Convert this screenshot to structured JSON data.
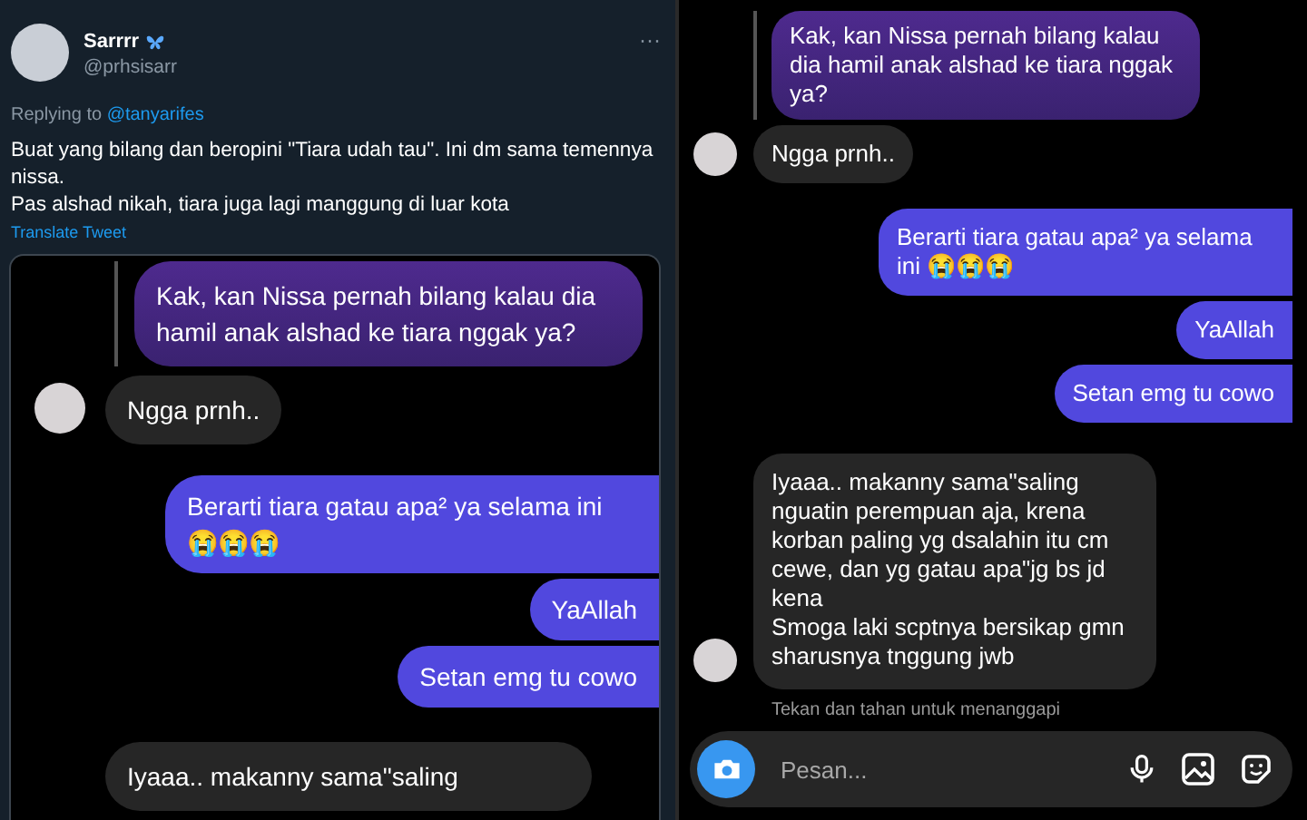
{
  "tweet": {
    "author": "Sarrrr",
    "handle": "@prhsisarr",
    "replying_prefix": "Replying to",
    "reply_handle": "@tanyarifes",
    "paragraphs": [
      "Buat yang bilang dan beropini \"Tiara udah tau\". Ini dm sama temennya nissa.",
      "Pas alshad nikah, tiara juga lagi manggung di luar kota"
    ],
    "translate": "Translate Tweet",
    "more": "···"
  },
  "left_chat": {
    "messages": [
      {
        "kind": "quote",
        "text": "Kak, kan Nissa pernah bilang kalau dia hamil anak alshad ke tiara nggak ya?"
      },
      {
        "kind": "received",
        "text": "Ngga prnh..",
        "avatar": true
      },
      {
        "kind": "sent",
        "text": "Berarti tiara gatau apa² ya selama ini 😭😭😭"
      },
      {
        "kind": "sent",
        "text": "YaAllah"
      },
      {
        "kind": "sent",
        "text": "Setan emg tu cowo"
      },
      {
        "kind": "received",
        "text": "Iyaaa.. makanny sama\"saling",
        "avatar": false
      }
    ]
  },
  "right_chat": {
    "messages": [
      {
        "kind": "quote",
        "text": "Kak, kan Nissa pernah bilang kalau dia hamil anak alshad ke tiara nggak ya?"
      },
      {
        "kind": "received",
        "text": "Ngga prnh..",
        "avatar": true
      },
      {
        "kind": "sent",
        "text": "Berarti tiara gatau apa² ya selama ini 😭😭😭"
      },
      {
        "kind": "sent",
        "text": "YaAllah"
      },
      {
        "kind": "sent",
        "text": "Setan emg tu cowo"
      },
      {
        "kind": "received",
        "text": "Iyaaa.. makanny sama\"saling nguatin perempuan aja, krena korban paling yg dsalahin itu cm cewe, dan yg gatau apa\"jg bs jd kena\nSmoga laki scptnya bersikap gmn sharusnya tnggung jwb",
        "avatar": true
      }
    ],
    "hint": "Tekan dan tahan untuk menanggapi",
    "composer": {
      "placeholder": "Pesan..."
    }
  }
}
